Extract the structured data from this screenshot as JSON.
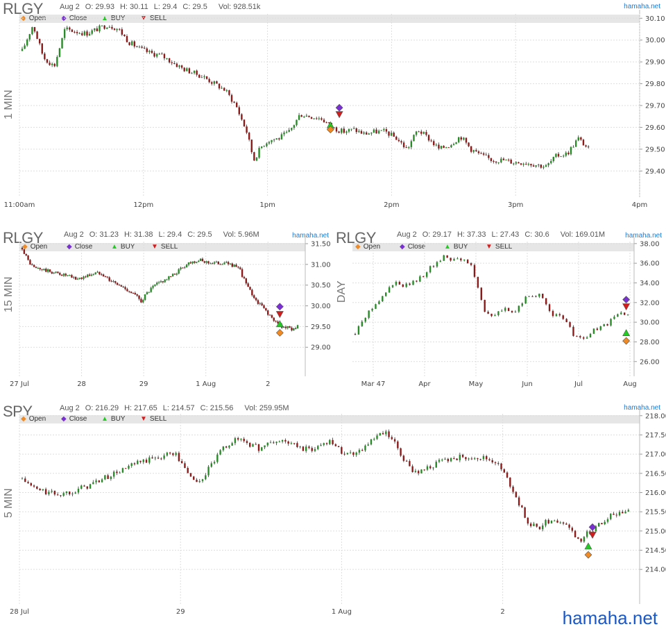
{
  "brand": "hamaha.net",
  "footer_brand": "hamaha.net",
  "legend": {
    "open": "Open",
    "close": "Close",
    "buy": "BUY",
    "sell": "SELL"
  },
  "colors": {
    "up": "#2a8a2a",
    "down": "#8b1a1a",
    "open_marker": "#f08a24",
    "close_marker": "#7a2fd4",
    "buy_marker": "#22cc22",
    "sell_marker": "#d41c1c",
    "grid": "#dddddd",
    "legend_bg": "#e6e6e6",
    "brand": "#1a7bd6"
  },
  "panels": [
    {
      "symbol": "RLGY",
      "timeframe": "1 MIN",
      "ohlc": {
        "date": "Aug 2",
        "open": "O: 29.93",
        "high": "H: 30.11",
        "low": "L: 29.4",
        "close": "C: 29.5",
        "volume": "Vol: 928.51k"
      },
      "brand": "hamaha.net",
      "chart_data": {
        "type": "candlestick",
        "x_ticks": [
          "11:00am",
          "12pm",
          "1pm",
          "2pm",
          "3pm",
          "4pm"
        ],
        "y_ticks": [
          "30.10",
          "30.00",
          "29.90",
          "29.80",
          "29.70",
          "29.60",
          "29.50",
          "29.40"
        ],
        "ylim": [
          29.28,
          30.12
        ],
        "path": [
          [
            0,
            29.95
          ],
          [
            6,
            30.07
          ],
          [
            12,
            29.92
          ],
          [
            18,
            29.88
          ],
          [
            24,
            30.05
          ],
          [
            30,
            30.04
          ],
          [
            36,
            30.03
          ],
          [
            42,
            30.05
          ],
          [
            48,
            30.07
          ],
          [
            54,
            30.05
          ],
          [
            60,
            29.99
          ],
          [
            66,
            29.96
          ],
          [
            72,
            29.94
          ],
          [
            78,
            29.93
          ],
          [
            84,
            29.9
          ],
          [
            90,
            29.87
          ],
          [
            96,
            29.85
          ],
          [
            102,
            29.83
          ],
          [
            108,
            29.8
          ],
          [
            114,
            29.77
          ],
          [
            120,
            29.7
          ],
          [
            126,
            29.58
          ],
          [
            130,
            29.45
          ],
          [
            134,
            29.51
          ],
          [
            138,
            29.54
          ],
          [
            144,
            29.55
          ],
          [
            150,
            29.58
          ],
          [
            156,
            29.66
          ],
          [
            162,
            29.65
          ],
          [
            168,
            29.64
          ],
          [
            174,
            29.6
          ],
          [
            180,
            29.58
          ],
          [
            186,
            29.59
          ],
          [
            192,
            29.57
          ],
          [
            198,
            29.58
          ],
          [
            204,
            29.58
          ],
          [
            210,
            29.55
          ],
          [
            216,
            29.5
          ],
          [
            222,
            29.59
          ],
          [
            228,
            29.55
          ],
          [
            234,
            29.5
          ],
          [
            240,
            29.52
          ],
          [
            246,
            29.56
          ],
          [
            252,
            29.5
          ],
          [
            258,
            29.47
          ],
          [
            264,
            29.45
          ],
          [
            270,
            29.45
          ],
          [
            276,
            29.44
          ],
          [
            282,
            29.44
          ],
          [
            288,
            29.43
          ],
          [
            294,
            29.42
          ],
          [
            300,
            29.47
          ],
          [
            306,
            29.48
          ],
          [
            312,
            29.55
          ],
          [
            318,
            29.5
          ]
        ],
        "x_max": 345,
        "markers": [
          {
            "kind": "buy",
            "x": 173,
            "y": 29.61
          },
          {
            "kind": "open",
            "x": 173,
            "y": 29.59
          },
          {
            "kind": "close",
            "x": 178,
            "y": 29.69
          },
          {
            "kind": "sell",
            "x": 178,
            "y": 29.66
          }
        ]
      }
    },
    {
      "symbol": "RLGY",
      "timeframe": "15 MIN",
      "ohlc": {
        "date": "Aug 2",
        "open": "O: 31.23",
        "high": "H: 31.38",
        "low": "L: 29.4",
        "close": "C: 29.5",
        "volume": "Vol: 5.96M"
      },
      "brand": "hamaha.net",
      "chart_data": {
        "type": "candlestick",
        "x_ticks": [
          "27 Jul",
          "28",
          "29",
          "1 Aug",
          "2"
        ],
        "y_ticks": [
          "31.50",
          "31.00",
          "30.50",
          "30.00",
          "29.50",
          "29.00"
        ],
        "ylim": [
          28.3,
          31.55
        ],
        "path": [
          [
            0,
            31.4
          ],
          [
            4,
            31.1
          ],
          [
            8,
            30.92
          ],
          [
            14,
            30.88
          ],
          [
            20,
            30.82
          ],
          [
            26,
            30.78
          ],
          [
            32,
            30.72
          ],
          [
            38,
            30.65
          ],
          [
            44,
            30.7
          ],
          [
            50,
            30.78
          ],
          [
            56,
            30.8
          ],
          [
            62,
            30.62
          ],
          [
            68,
            30.5
          ],
          [
            74,
            30.4
          ],
          [
            80,
            30.25
          ],
          [
            84,
            30.12
          ],
          [
            88,
            30.3
          ],
          [
            94,
            30.5
          ],
          [
            100,
            30.62
          ],
          [
            106,
            30.72
          ],
          [
            112,
            30.9
          ],
          [
            118,
            31.05
          ],
          [
            124,
            31.1
          ],
          [
            130,
            31.06
          ],
          [
            136,
            31.03
          ],
          [
            142,
            31.04
          ],
          [
            148,
            31.0
          ],
          [
            154,
            30.85
          ],
          [
            160,
            30.4
          ],
          [
            166,
            30.1
          ],
          [
            172,
            29.9
          ],
          [
            178,
            29.62
          ],
          [
            184,
            29.5
          ],
          [
            190,
            29.45
          ],
          [
            196,
            29.5
          ]
        ],
        "x_max": 198,
        "markers": [
          {
            "kind": "close",
            "x": 182,
            "y": 29.98
          },
          {
            "kind": "sell",
            "x": 182,
            "y": 29.8
          },
          {
            "kind": "buy",
            "x": 182,
            "y": 29.56
          },
          {
            "kind": "open",
            "x": 182,
            "y": 29.35
          }
        ]
      }
    },
    {
      "symbol": "RLGY",
      "timeframe": "DAY",
      "ohlc": {
        "date": "Aug 2",
        "open": "O: 29.17",
        "high": "H: 37.33",
        "low": "L: 27.43",
        "close": "C: 30.6",
        "volume": "Vol: 169.01M"
      },
      "brand": "hamaha.net",
      "chart_data": {
        "type": "candlestick",
        "x_ticks": [
          "Mar 47",
          "Apr",
          "May",
          "Jun",
          "Jul",
          "Aug"
        ],
        "y_ticks": [
          "38.00",
          "36.00",
          "34.00",
          "32.00",
          "30.00",
          "28.00",
          "26.00"
        ],
        "ylim": [
          24.5,
          38.2
        ],
        "path": [
          [
            0,
            28.8
          ],
          [
            4,
            30.2
          ],
          [
            8,
            31.0
          ],
          [
            12,
            32.0
          ],
          [
            16,
            32.5
          ],
          [
            20,
            33.5
          ],
          [
            24,
            34.0
          ],
          [
            28,
            33.6
          ],
          [
            32,
            33.9
          ],
          [
            36,
            34.2
          ],
          [
            40,
            34.8
          ],
          [
            44,
            35.6
          ],
          [
            48,
            36.0
          ],
          [
            52,
            36.8
          ],
          [
            56,
            36.4
          ],
          [
            60,
            36.6
          ],
          [
            64,
            36.2
          ],
          [
            68,
            35.8
          ],
          [
            72,
            33.5
          ],
          [
            76,
            31.2
          ],
          [
            80,
            30.5
          ],
          [
            84,
            31.0
          ],
          [
            88,
            31.5
          ],
          [
            92,
            30.8
          ],
          [
            96,
            31.5
          ],
          [
            100,
            32.6
          ],
          [
            104,
            32.8
          ],
          [
            108,
            32.7
          ],
          [
            112,
            31.8
          ],
          [
            116,
            30.8
          ],
          [
            120,
            30.5
          ],
          [
            124,
            30.0
          ],
          [
            128,
            28.8
          ],
          [
            132,
            28.3
          ],
          [
            136,
            28.5
          ],
          [
            140,
            29.2
          ],
          [
            144,
            29.5
          ],
          [
            148,
            29.8
          ],
          [
            152,
            30.5
          ],
          [
            156,
            31.0
          ],
          [
            160,
            30.6
          ]
        ],
        "x_max": 162,
        "markers": [
          {
            "kind": "close",
            "x": 159,
            "y": 32.3
          },
          {
            "kind": "sell",
            "x": 159,
            "y": 31.6
          },
          {
            "kind": "buy",
            "x": 159,
            "y": 28.9
          },
          {
            "kind": "open",
            "x": 159,
            "y": 28.1
          }
        ]
      }
    },
    {
      "symbol": "SPY",
      "timeframe": "5 MIN",
      "ohlc": {
        "date": "Aug 2",
        "open": "O: 216.29",
        "high": "H: 217.65",
        "low": "L: 214.57",
        "close": "C: 215.56",
        "volume": "Vol: 259.95M"
      },
      "brand": "hamaha.net",
      "chart_data": {
        "type": "candlestick",
        "x_ticks": [
          "28 Jul",
          "29",
          "1 Aug",
          "2"
        ],
        "y_ticks": [
          "218.00",
          "217.50",
          "217.00",
          "216.50",
          "216.00",
          "215.50",
          "215.00",
          "214.50",
          "214.00"
        ],
        "ylim": [
          213.1,
          218.05
        ],
        "path": [
          [
            0,
            216.35
          ],
          [
            6,
            216.1
          ],
          [
            12,
            216.0
          ],
          [
            18,
            215.95
          ],
          [
            24,
            216.05
          ],
          [
            30,
            216.15
          ],
          [
            36,
            216.3
          ],
          [
            42,
            216.45
          ],
          [
            48,
            216.6
          ],
          [
            54,
            216.75
          ],
          [
            60,
            216.85
          ],
          [
            66,
            216.95
          ],
          [
            72,
            217.05
          ],
          [
            76,
            216.7
          ],
          [
            80,
            216.4
          ],
          [
            84,
            216.25
          ],
          [
            88,
            216.6
          ],
          [
            92,
            216.9
          ],
          [
            96,
            217.2
          ],
          [
            100,
            217.35
          ],
          [
            104,
            217.4
          ],
          [
            108,
            217.25
          ],
          [
            112,
            217.15
          ],
          [
            118,
            217.3
          ],
          [
            124,
            217.35
          ],
          [
            130,
            217.2
          ],
          [
            136,
            217.1
          ],
          [
            142,
            217.25
          ],
          [
            146,
            217.4
          ],
          [
            150,
            217.1
          ],
          [
            156,
            217.0
          ],
          [
            162,
            217.2
          ],
          [
            168,
            217.45
          ],
          [
            172,
            217.55
          ],
          [
            176,
            217.3
          ],
          [
            180,
            216.9
          ],
          [
            184,
            216.6
          ],
          [
            188,
            216.55
          ],
          [
            194,
            216.7
          ],
          [
            200,
            216.85
          ],
          [
            206,
            216.9
          ],
          [
            212,
            216.95
          ],
          [
            218,
            216.9
          ],
          [
            224,
            216.8
          ],
          [
            228,
            216.5
          ],
          [
            232,
            216.1
          ],
          [
            236,
            215.6
          ],
          [
            240,
            215.2
          ],
          [
            244,
            215.05
          ],
          [
            248,
            215.25
          ],
          [
            252,
            215.3
          ],
          [
            256,
            215.2
          ],
          [
            260,
            215.0
          ],
          [
            264,
            214.75
          ],
          [
            268,
            214.95
          ],
          [
            272,
            215.15
          ],
          [
            276,
            215.3
          ],
          [
            280,
            215.45
          ],
          [
            284,
            215.5
          ],
          [
            288,
            215.55
          ]
        ],
        "x_max": 291,
        "markers": [
          {
            "kind": "close",
            "x": 270,
            "y": 215.1
          },
          {
            "kind": "sell",
            "x": 270,
            "y": 214.9
          },
          {
            "kind": "buy",
            "x": 268,
            "y": 214.6
          },
          {
            "kind": "open",
            "x": 268,
            "y": 214.38
          }
        ]
      }
    }
  ]
}
